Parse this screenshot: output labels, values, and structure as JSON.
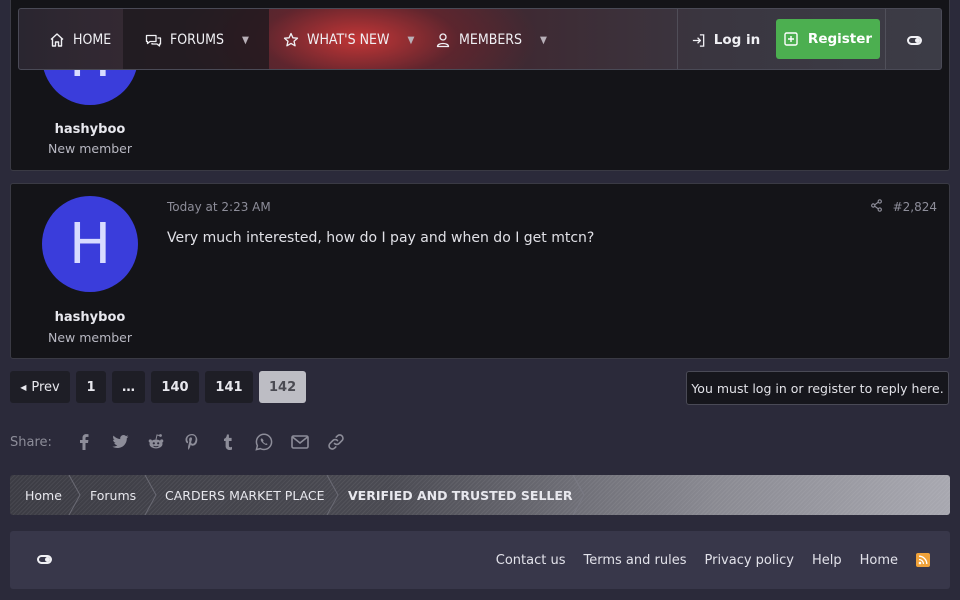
{
  "nav": {
    "home": "Home",
    "forums": "Forums",
    "whats_new": "What's new",
    "members": "Members",
    "login": "Log in",
    "register": "Register"
  },
  "posts": [
    {
      "avatar_letter": "H",
      "username": "hashyboo",
      "user_title": "New member"
    },
    {
      "avatar_letter": "H",
      "username": "hashyboo",
      "user_title": "New member",
      "date": "Today at 2:23 AM",
      "post_number": "#2,824",
      "body": "Very much interested, how do I pay and when do I get mtcn?"
    }
  ],
  "pagination": {
    "prev": "Prev",
    "pages": [
      "1",
      "…",
      "140",
      "141",
      "142"
    ],
    "current": "142"
  },
  "reply_note": "You must log in or register to reply here.",
  "share": {
    "label": "Share:",
    "icons": [
      "facebook-icon",
      "twitter-icon",
      "reddit-icon",
      "pinterest-icon",
      "tumblr-icon",
      "whatsapp-icon",
      "email-icon",
      "link-icon"
    ]
  },
  "breadcrumb": [
    "Home",
    "Forums",
    "CARDERS MARKET PLACE",
    "VERIFIED AND TRUSTED SELLER"
  ],
  "footer": {
    "links": [
      "Contact us",
      "Terms and rules",
      "Privacy policy",
      "Help",
      "Home"
    ]
  },
  "colors": {
    "avatar": "#3a3ddb",
    "register": "#4caf50",
    "rss": "#f0a23a",
    "page_bg": "#2b2a3a"
  }
}
